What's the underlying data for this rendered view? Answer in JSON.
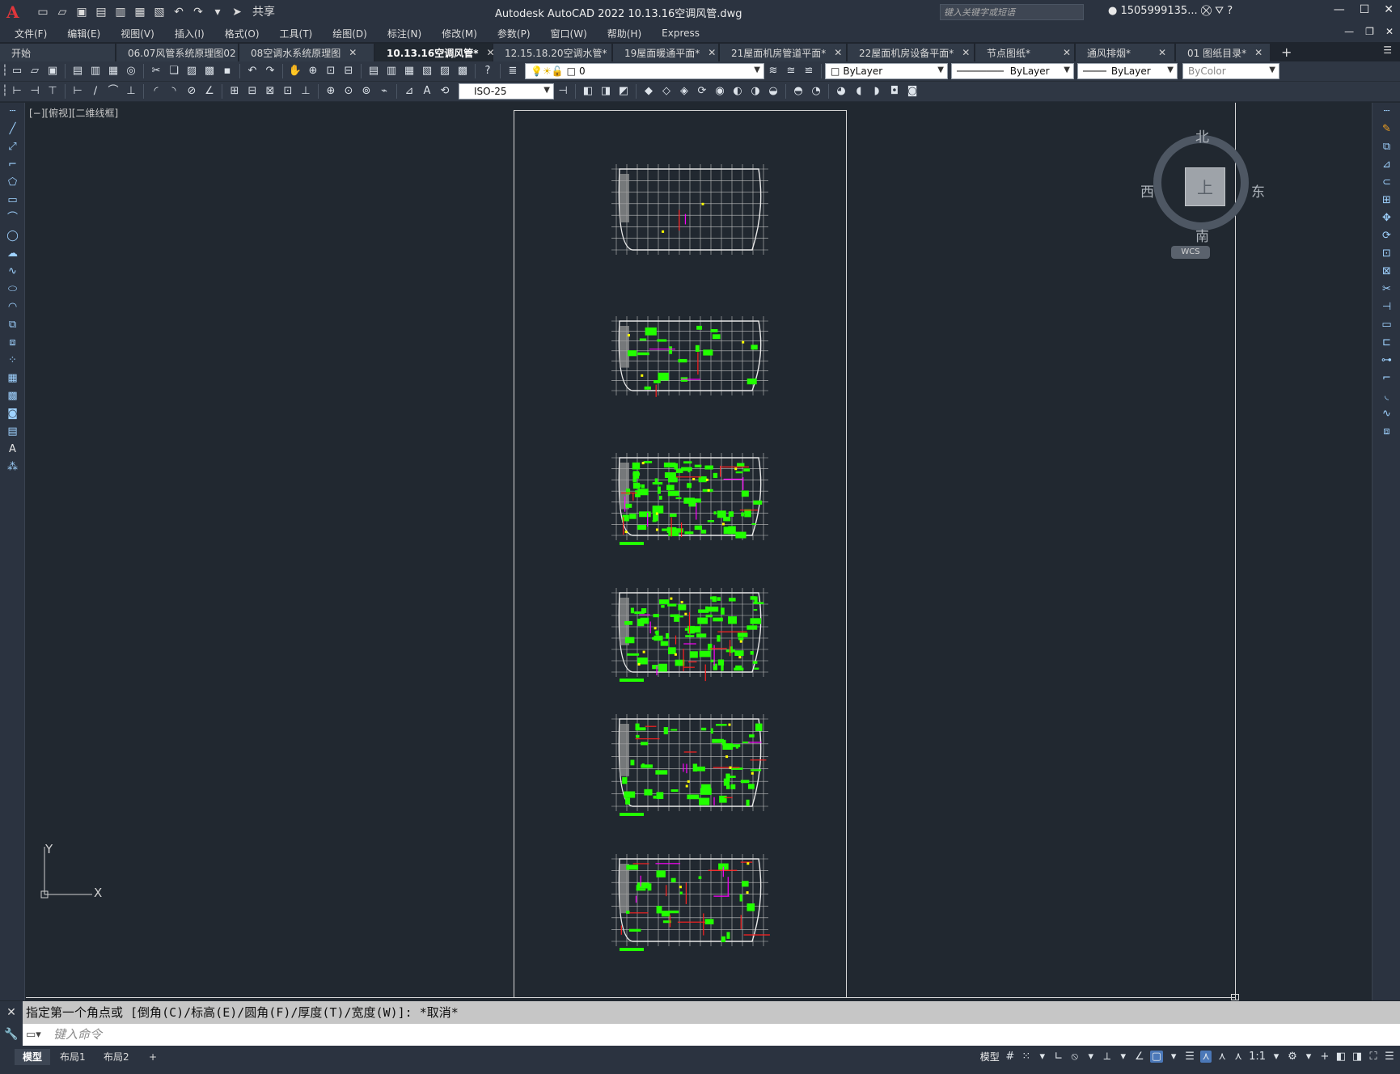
{
  "app": {
    "title": "Autodesk AutoCAD 2022    10.13.16空调风管.dwg",
    "logo": "A",
    "share_label": "共享",
    "search_placeholder": "键入关键字或短语",
    "user": "1505999135...",
    "window_controls": [
      "—",
      "☐",
      "✕"
    ]
  },
  "menu": {
    "items": [
      "文件(F)",
      "编辑(E)",
      "视图(V)",
      "插入(I)",
      "格式(O)",
      "工具(T)",
      "绘图(D)",
      "标注(N)",
      "修改(M)",
      "参数(P)",
      "窗口(W)",
      "帮助(H)",
      "Express"
    ]
  },
  "tabs": [
    {
      "label": "开始",
      "close": "",
      "active": false
    },
    {
      "label": "06.07风管系统原理图02",
      "close": "✕",
      "active": false
    },
    {
      "label": "08空调水系统原理图",
      "close": "✕",
      "active": false
    },
    {
      "label": "10.13.16空调风管*",
      "close": "✕",
      "active": true
    },
    {
      "label": "12.15.18.20空调水管*",
      "close": "✕",
      "active": false
    },
    {
      "label": "19屋面暖通平面*",
      "close": "✕",
      "active": false
    },
    {
      "label": "21屋面机房管道平面*",
      "close": "✕",
      "active": false
    },
    {
      "label": "22屋面机房设备平面*",
      "close": "✕",
      "active": false
    },
    {
      "label": "节点图纸*",
      "close": "✕",
      "active": false
    },
    {
      "label": "通风排烟*",
      "close": "✕",
      "active": false
    },
    {
      "label": "01 图纸目录*",
      "close": "✕",
      "active": false
    }
  ],
  "toolbar": {
    "layer_value": "0",
    "color_value": "ByLayer",
    "linetype_value": "ByLayer",
    "lineweight_value": "ByLayer",
    "plotstyle_value": "ByColor",
    "dimstyle_value": "ISO-25"
  },
  "viewport": {
    "label": "[−][俯视][二维线框]"
  },
  "viewcube": {
    "north": "北",
    "south": "南",
    "west": "西",
    "east": "东",
    "face": "上",
    "wcs": "WCS"
  },
  "ucs": {
    "x_label": "X",
    "y_label": "Y"
  },
  "command": {
    "history": "指定第一个角点或 [倒角(C)/标高(E)/圆角(F)/厚度(T)/宽度(W)]: *取消*",
    "placeholder": "键入命令"
  },
  "status": {
    "layout_tabs": [
      "模型",
      "布局1",
      "布局2"
    ],
    "model_label": "模型",
    "scale": "1:1"
  },
  "colors": {
    "background": "#212830",
    "accent_green": "#22ff00",
    "accent_red": "#ff2020",
    "accent_magenta": "#ff00ff",
    "accent_yellow": "#ffff00",
    "grid_grey": "#c0c0c0"
  }
}
